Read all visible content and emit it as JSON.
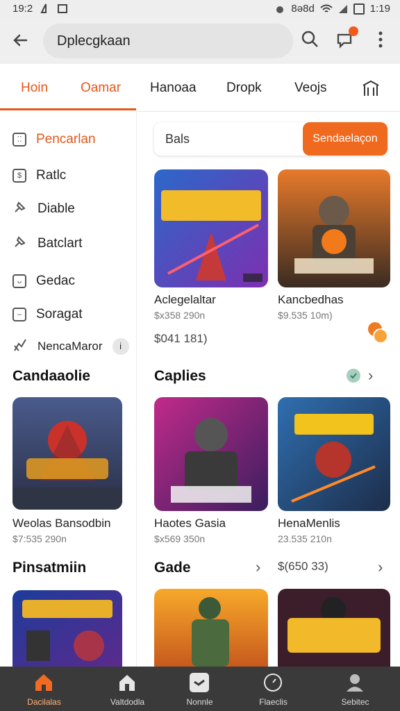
{
  "status": {
    "time": "19:2",
    "right_text": "8ə8d",
    "clock": "1:19"
  },
  "appbar": {
    "search_text": "Dplecgkaan"
  },
  "tabs": [
    {
      "label": "Hoin"
    },
    {
      "label": "Oamar"
    },
    {
      "label": "Hanoaa"
    },
    {
      "label": "Dropk"
    },
    {
      "label": "Veojs"
    }
  ],
  "sidebar": {
    "items": [
      {
        "label": "Pencarlan",
        "icon": "grid-icon"
      },
      {
        "label": "Ratlc",
        "icon": "tag-icon"
      },
      {
        "label": "Diable",
        "icon": "pin-icon"
      },
      {
        "label": "Batclart",
        "icon": "pin-icon"
      },
      {
        "label": "Gedac",
        "icon": "face-icon"
      },
      {
        "label": "Soragat",
        "icon": "minus-box-icon"
      },
      {
        "label": "NencaMaror",
        "icon": "bolt-icon"
      }
    ],
    "section1_title": "Candaaolie",
    "game1": {
      "title": "Weolas Bansodbin",
      "price": "$7:535 290n"
    },
    "section2_title": "Pinsatmiin"
  },
  "main": {
    "search_placeholder": "Bals",
    "search_button": "Sendaelaçon",
    "card1": {
      "title": "Aclegelaltar",
      "sub": "$x358 290n",
      "price": "$041 181)"
    },
    "card2": {
      "title": "Kancbedhas",
      "sub": "$9.535 10m)"
    },
    "section_caplies": "Caplies",
    "card3": {
      "title": "Haotes Gasia",
      "sub": "$x569 350n"
    },
    "card4": {
      "title": "HenaMenlis",
      "sub": "23.535 210n"
    },
    "section_gade": "Gade",
    "gade_price": "$(650 33)"
  },
  "bottom_nav": [
    {
      "label": "Dacilalas"
    },
    {
      "label": "Valtdodla"
    },
    {
      "label": "Nonnle"
    },
    {
      "label": "Flaeclis"
    },
    {
      "label": "Sebitec"
    }
  ],
  "colors": {
    "accent": "#e5581a",
    "button": "#ef6a1f",
    "nav_bg": "#3a3a3a"
  }
}
